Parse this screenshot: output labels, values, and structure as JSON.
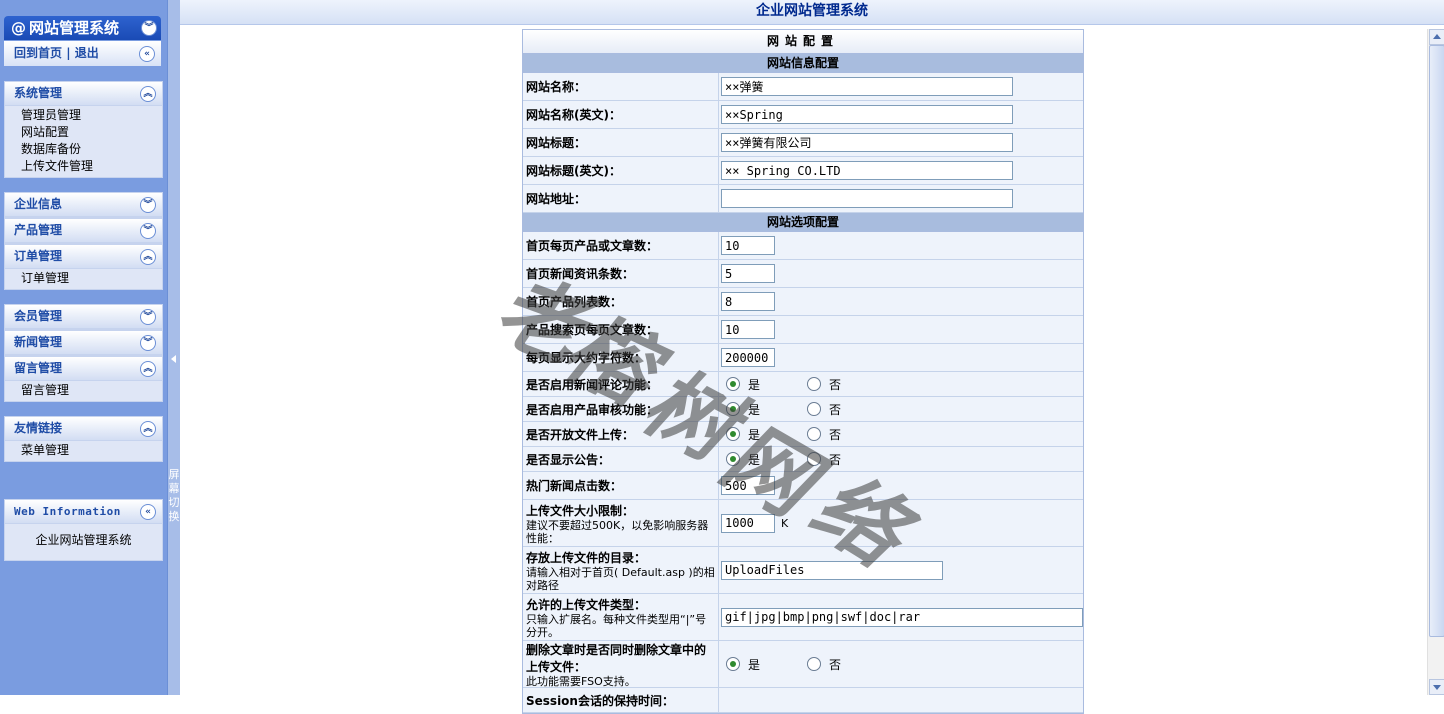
{
  "sidebar": {
    "title": "网站管理系统",
    "title_at": "@",
    "home": "回到首页",
    "separator": "|",
    "logout": "退出",
    "toggle_label": "屏幕切换",
    "panels": [
      {
        "label": "系统管理",
        "expanded": true,
        "items": [
          "管理员管理",
          "网站配置",
          "数据库备份",
          "上传文件管理"
        ]
      },
      {
        "label": "企业信息",
        "expanded": false,
        "items": []
      },
      {
        "label": "产品管理",
        "expanded": false,
        "items": []
      },
      {
        "label": "订单管理",
        "expanded": true,
        "items": [
          "订单管理"
        ]
      },
      {
        "label": "会员管理",
        "expanded": false,
        "items": []
      },
      {
        "label": "新闻管理",
        "expanded": false,
        "items": []
      },
      {
        "label": "留言管理",
        "expanded": true,
        "items": [
          "留言管理"
        ]
      },
      {
        "label": "友情链接",
        "expanded": true,
        "items": [
          "菜单管理"
        ]
      }
    ],
    "web_info": {
      "label": "Web Information",
      "text": "企业网站管理系统"
    }
  },
  "header": {
    "title": "企业网站管理系统"
  },
  "config": {
    "title": "网站配置",
    "sections": {
      "info": "网站信息配置",
      "options": "网站选项配置"
    },
    "fields": {
      "site_name": {
        "label": "网站名称：",
        "value": "××弹簧"
      },
      "site_name_en": {
        "label": "网站名称(英文)：",
        "value": "××Spring"
      },
      "site_title": {
        "label": "网站标题：",
        "value": "××弹簧有限公司"
      },
      "site_title_en": {
        "label": "网站标题(英文)：",
        "value": "×× Spring CO.LTD"
      },
      "site_url": {
        "label": "网站地址：",
        "value": ""
      },
      "home_items": {
        "label": "首页每页产品或文章数：",
        "value": "10"
      },
      "home_news": {
        "label": "首页新闻资讯条数：",
        "value": "5"
      },
      "home_products": {
        "label": "首页产品列表数：",
        "value": "8"
      },
      "search_items": {
        "label": "产品搜索页每页文章数：",
        "value": "10"
      },
      "max_chars": {
        "label": "每页显示大约字符数：",
        "value": "200000"
      },
      "news_comment": {
        "label": "是否启用新闻评论功能：",
        "selected": "yes"
      },
      "product_audit": {
        "label": "是否启用产品审核功能：",
        "selected": "yes"
      },
      "file_upload": {
        "label": "是否开放文件上传：",
        "selected": "yes"
      },
      "show_notice": {
        "label": "是否显示公告：",
        "selected": "yes"
      },
      "hot_clicks": {
        "label": "热门新闻点击数：",
        "value": "500"
      },
      "upload_limit": {
        "label": "上传文件大小限制：",
        "note": "建议不要超过500K，以免影响服务器性能：",
        "value": "1000",
        "unit": "K"
      },
      "upload_dir": {
        "label": "存放上传文件的目录：",
        "note": "请输入相对于首页( Default.asp )的相对路径",
        "value": "UploadFiles"
      },
      "allowed_types": {
        "label": "允许的上传文件类型：",
        "note": "只输入扩展名。每种文件类型用“|”号分开。",
        "value": "gif|jpg|bmp|png|swf|doc|rar"
      },
      "delete_files": {
        "label": "删除文章时是否同时删除文章中的上传文件：",
        "note": "此功能需要FSO支持。",
        "selected": "yes"
      },
      "session": {
        "label": "Session会话的保持时间："
      }
    },
    "yes": "是",
    "no": "否"
  },
  "watermark": "老榕树网络"
}
